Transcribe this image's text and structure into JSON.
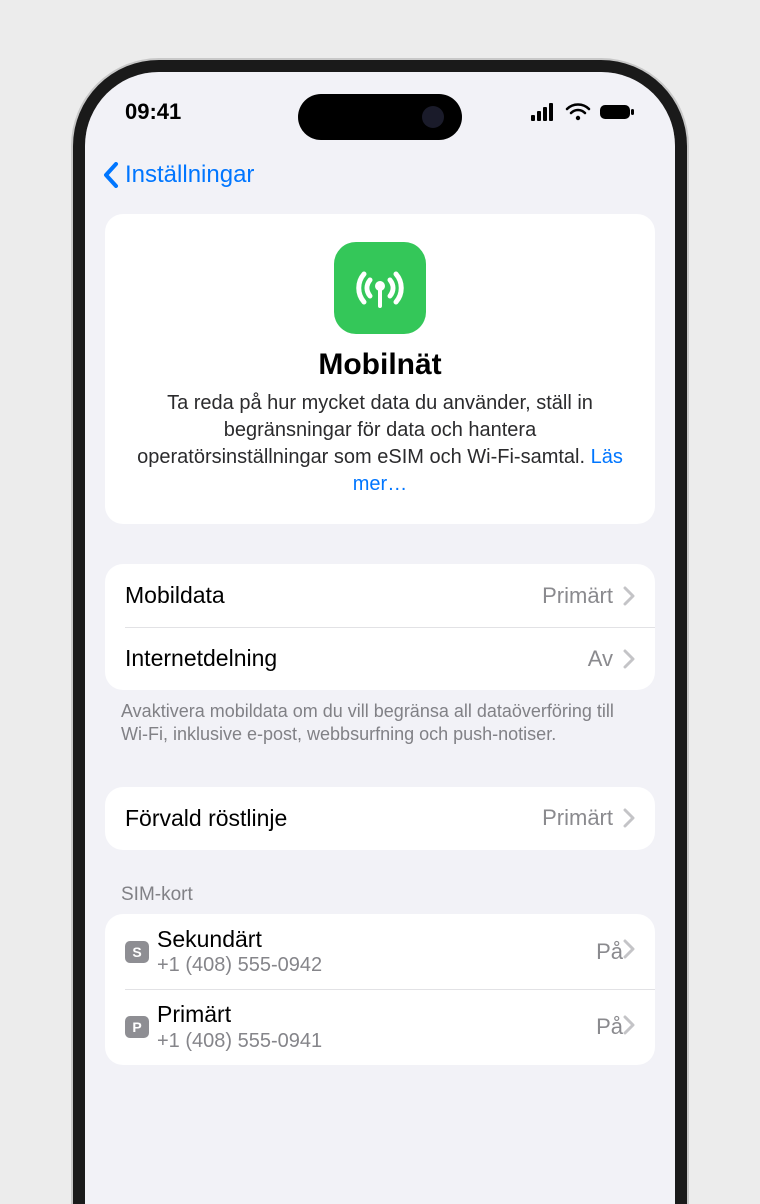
{
  "statusbar": {
    "time": "09:41"
  },
  "nav": {
    "back_label": "Inställningar"
  },
  "header": {
    "title": "Mobilnät",
    "description": "Ta reda på hur mycket data du använder, ställ in begränsningar för data och hantera operatörsinställningar som eSIM och Wi-Fi-samtal. ",
    "more": "Läs mer…"
  },
  "group1": {
    "rows": [
      {
        "label": "Mobildata",
        "value": "Primärt"
      },
      {
        "label": "Internetdelning",
        "value": "Av"
      }
    ],
    "footer": "Avaktivera mobildata om du vill begränsa all dataöverföring till Wi-Fi, inklusive e-post, webbsurfning och push-notiser."
  },
  "group2": {
    "rows": [
      {
        "label": "Förvald röstlinje",
        "value": "Primärt"
      }
    ]
  },
  "sim": {
    "header": "SIM-kort",
    "items": [
      {
        "badge": "S",
        "name": "Sekundärt",
        "phone": "+1 (408) 555-0942",
        "state": "På"
      },
      {
        "badge": "P",
        "name": "Primärt",
        "phone": "+1 (408) 555-0941",
        "state": "På"
      }
    ]
  }
}
